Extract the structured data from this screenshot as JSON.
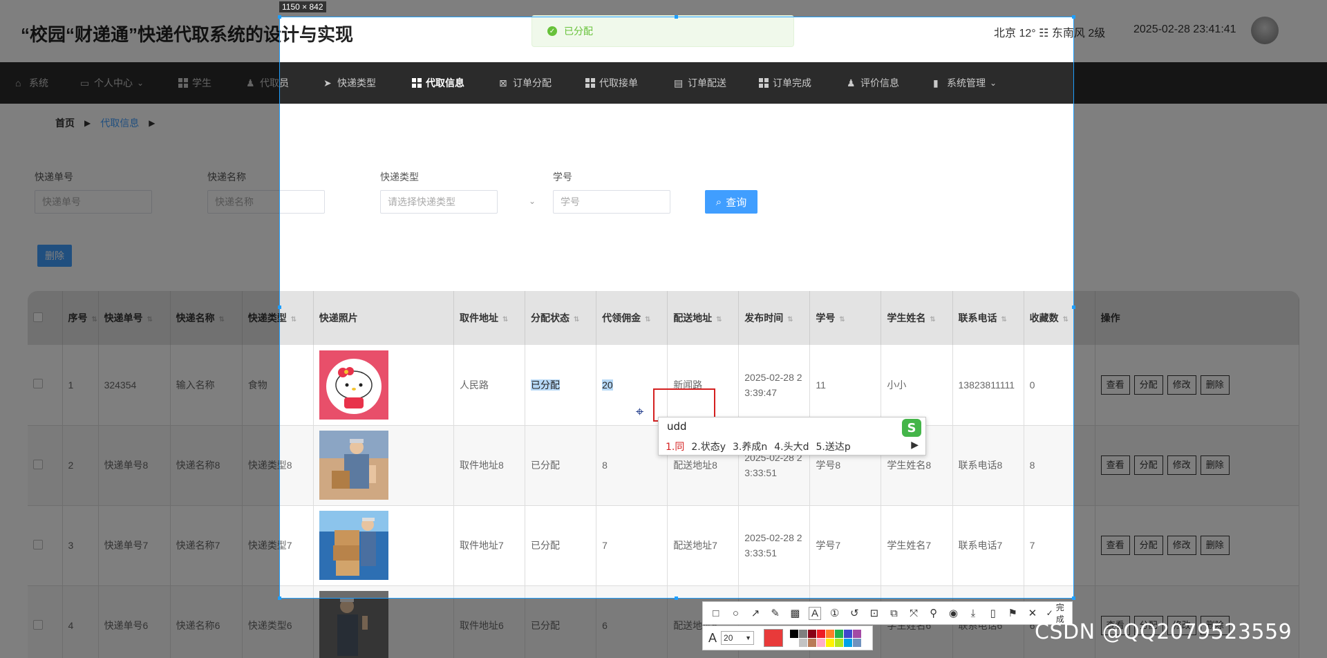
{
  "header": {
    "title": "“校园“财递通”快递代取系统的设计与实现",
    "weather": "北京  12°  ☷  东南风  2级",
    "datetime": "2025-02-28 23:41:41"
  },
  "nav": [
    {
      "label": "系统",
      "icon": "home-icon",
      "glyph": "⌂"
    },
    {
      "label": "个人中心",
      "icon": "calendar-icon",
      "glyph": "▭",
      "dropdown": true
    },
    {
      "label": "学生",
      "icon": "grid-icon",
      "glyph": ""
    },
    {
      "label": "代取员",
      "icon": "user-house-icon",
      "glyph": "♟"
    },
    {
      "label": "快递类型",
      "icon": "send-icon",
      "glyph": "➤"
    },
    {
      "label": "代取信息",
      "icon": "grid-icon",
      "glyph": "",
      "active": true
    },
    {
      "label": "订单分配",
      "icon": "clipboard-icon",
      "glyph": "⊠"
    },
    {
      "label": "代取接单",
      "icon": "grid-icon",
      "glyph": ""
    },
    {
      "label": "订单配送",
      "icon": "clipboard-icon",
      "glyph": "▤"
    },
    {
      "label": "订单完成",
      "icon": "grid-icon",
      "glyph": ""
    },
    {
      "label": "评价信息",
      "icon": "user-icon",
      "glyph": "♟"
    },
    {
      "label": "系统管理",
      "icon": "bar-chart-icon",
      "glyph": "▮",
      "dropdown": true
    }
  ],
  "breadcrumb": {
    "home": "首页",
    "current": "代取信息"
  },
  "search": {
    "tracking_label": "快递单号",
    "tracking_placeholder": "快递单号",
    "name_label": "快递名称",
    "name_placeholder": "快递名称",
    "type_label": "快递类型",
    "type_placeholder": "请选择快递类型",
    "student_label": "学号",
    "student_placeholder": "学号",
    "query_button": "查询"
  },
  "delete_button": "删除",
  "table": {
    "headers": [
      "序号",
      "快递单号",
      "快递名称",
      "快递类型",
      "快递照片",
      "取件地址",
      "分配状态",
      "代领佣金",
      "配送地址",
      "发布时间",
      "学号",
      "学生姓名",
      "联系电话",
      "收藏数",
      "操作"
    ],
    "sortable": [
      true,
      true,
      true,
      true,
      false,
      true,
      true,
      true,
      true,
      true,
      true,
      true,
      true,
      true,
      false
    ],
    "row_actions": [
      "查看",
      "分配",
      "修改",
      "删除"
    ],
    "rows": [
      {
        "index": "1",
        "tracking": "324354",
        "name": "输入名称",
        "type": "食物",
        "photo": "hello-kitty",
        "pickup": "人民路",
        "status": "已分配",
        "fee": "20",
        "delivery": "新闻路",
        "time": "2025-02-28 23:39:47",
        "student_id": "11",
        "student_name": "小小",
        "phone": "13823811111",
        "favorites": "0"
      },
      {
        "index": "2",
        "tracking": "快递单号8",
        "name": "快递名称8",
        "type": "快递类型8",
        "photo": "courier",
        "pickup": "取件地址8",
        "status": "已分配",
        "fee": "8",
        "delivery": "配送地址8",
        "time": "2025-02-28 23:33:51",
        "student_id": "学号8",
        "student_name": "学生姓名8",
        "phone": "联系电话8",
        "favorites": "8"
      },
      {
        "index": "3",
        "tracking": "快递单号7",
        "name": "快递名称7",
        "type": "快递类型7",
        "photo": "boxes",
        "pickup": "取件地址7",
        "status": "已分配",
        "fee": "7",
        "delivery": "配送地址7",
        "time": "2025-02-28 23:33:51",
        "student_id": "学号7",
        "student_name": "学生姓名7",
        "phone": "联系电话7",
        "favorites": "7"
      },
      {
        "index": "4",
        "tracking": "快递单号6",
        "name": "快递名称6",
        "type": "快递类型6",
        "photo": "worker",
        "pickup": "取件地址6",
        "status": "已分配",
        "fee": "6",
        "delivery": "配送地址6",
        "time": "",
        "student_id": "",
        "student_name": "学生姓名6",
        "phone": "联系电话6",
        "favorites": "6"
      }
    ]
  },
  "toast": {
    "message": "已分配"
  },
  "screenshot_tool": {
    "size_label": "1150 × 842",
    "font_size": "20",
    "done_label": "完成",
    "current_color": "#e83a3a",
    "palette": [
      "#000000",
      "#7f7f7f",
      "#880015",
      "#ed1c24",
      "#ff7f27",
      "#22b14c",
      "#3f48cc",
      "#a349a4",
      "#ffffff",
      "#c3c3c3",
      "#b97a57",
      "#ffaec9",
      "#fff200",
      "#b5e61d",
      "#00a2e8",
      "#7092be"
    ]
  },
  "ime": {
    "input": "udd",
    "candidates": [
      "1.同",
      "2.状态y",
      "3.养成n",
      "4.头大d",
      "5.送达p"
    ]
  },
  "watermark": "CSDN @QQ2079523559"
}
